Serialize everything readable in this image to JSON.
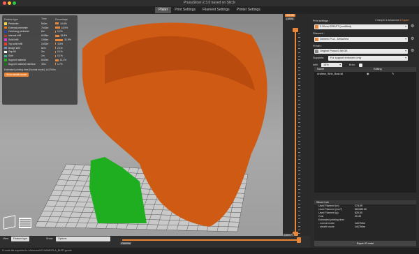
{
  "window": {
    "title": "PrusaSlicer-2.3.0 based on Slic3r"
  },
  "tabs": [
    "Plater",
    "Print Settings",
    "Filament Settings",
    "Printer Settings"
  ],
  "legend": {
    "headers": [
      "Feature type",
      "Time",
      "Percentage"
    ],
    "rows": [
      {
        "label": "Perimeter",
        "time": "5h0m",
        "pct": "14.6%",
        "pct_value": 14.6,
        "color": "#f5d94a"
      },
      {
        "label": "External perimeter",
        "time": "7h43m",
        "pct": "18.9%",
        "pct_value": 18.9,
        "color": "#f07b1c"
      },
      {
        "label": "Overhang perimeter",
        "time": "6m",
        "pct": "0.2%",
        "pct_value": 0.2,
        "color": "#2c3fa8"
      },
      {
        "label": "Internal infill",
        "time": "6h28m",
        "pct": "15.8%",
        "pct_value": 15.8,
        "color": "#b53a2f"
      },
      {
        "label": "Solid infill",
        "time": "13h5m",
        "pct": "31.9%",
        "pct_value": 31.9,
        "color": "#d23ad0"
      },
      {
        "label": "Top solid infill",
        "time": "1h32m",
        "pct": "3.8%",
        "pct_value": 3.8,
        "color": "#f0402b"
      },
      {
        "label": "Bridge infill",
        "time": "52m",
        "pct": "2.1%",
        "pct_value": 2.1,
        "color": "#6e8fbf"
      },
      {
        "label": "Gap fill",
        "time": "3m",
        "pct": "0.1%",
        "pct_value": 0.1,
        "color": "#ffffff"
      },
      {
        "label": "Skirt",
        "time": "1m",
        "pct": "0.1%",
        "pct_value": 0.1,
        "color": "#3fb0a0"
      },
      {
        "label": "Support material",
        "time": "5h23m",
        "pct": "13.1%",
        "pct_value": 13.1,
        "color": "#22b522"
      },
      {
        "label": "Support material interface",
        "time": "40m",
        "pct": "1.7%",
        "pct_value": 1.7,
        "color": "#1d6e1d"
      }
    ],
    "estimated": "Estimated printing time [Normal mode]:",
    "estimated_value": "1d17h0m",
    "stealth_button": "Show stealth mode"
  },
  "vslider": {
    "top": "320.30",
    "top2": "(1600)",
    "bottom": "0.20",
    "bottom2": "(1)"
  },
  "hslider": {
    "left": "4389998",
    "right": "4389977"
  },
  "view_controls": {
    "view_label": "View",
    "view_value": "Feature type",
    "show_label": "Show",
    "show_value": "Options"
  },
  "sidebar": {
    "print_settings_label": "Print settings :",
    "print_settings_value": "0.30mm DRAFT (modified)",
    "mode_simple": "Simple",
    "mode_advanced": "Advanced",
    "mode_expert": "Expert",
    "filament_label": "Filament :",
    "filament_value": "Generic PLA - Detached",
    "printer_label": "Printer :",
    "printer_value": "Original Prusa i3 MK3S",
    "supports_label": "Supports:",
    "supports_value": "For support enforcers only",
    "infill_label": "Infill:",
    "infill_value": "15%",
    "brim_label": "Brim:",
    "object_headers": [
      "Name",
      "Editing"
    ],
    "object_name": "Andrew_Sinh_Bust.stl",
    "sliced_title": "Sliced Info",
    "sliced_lines": [
      {
        "k": "Used Filament (m)",
        "v": "274.09"
      },
      {
        "k": "Used Filament (mm³)",
        "v": "661280.00"
      },
      {
        "k": "Used Filament (g)",
        "v": "820.00"
      },
      {
        "k": "Cost",
        "v": "20.49"
      },
      {
        "k": "Estimated printing time:",
        "v": ""
      },
      {
        "k": " - normal mode",
        "v": "1d17h0m"
      },
      {
        "k": " - stealth mode",
        "v": "1d17h0m"
      }
    ],
    "export_button": "Export G-code"
  },
  "status": "G-code file exported to /Volumes/NO NAME/PLA_BUST.gcode",
  "colors": {
    "accent": "#e8873a",
    "model": "#d45a1a",
    "support": "#22b522"
  }
}
